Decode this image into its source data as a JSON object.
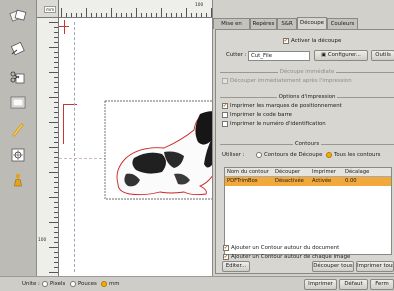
{
  "window": {
    "accent": "#f0b000"
  },
  "tools": {
    "items": [
      {
        "icon": "pages-icon"
      },
      {
        "icon": "edit-icon"
      },
      {
        "icon": "scissors-icon"
      },
      {
        "icon": "frame-icon"
      },
      {
        "icon": "link-icon"
      },
      {
        "icon": "target-icon"
      },
      {
        "icon": "person-icon"
      }
    ]
  },
  "ruler": {
    "unit": "mm",
    "top_label": "100",
    "left_label": "100"
  },
  "tabs": [
    "Mise en page",
    "Repères",
    "S&R",
    "Découpe",
    "Couleurs"
  ],
  "active_tab": "Découpe",
  "cut": {
    "activate_label": "Activer la découpe",
    "cutter_label": "Cutter :",
    "cutter_value": "Cut_File",
    "configure_label": "Configurer...",
    "tools_label": "Outils"
  },
  "immediate": {
    "group_label": "Découpe immédiate",
    "option_label": "Découper immédiatement après l'impression"
  },
  "print_options": {
    "group_label": "Options d'impression",
    "items": [
      {
        "label": "Imprimer les marques de positionnement",
        "checked": true
      },
      {
        "label": "Imprimer le code barre",
        "checked": false
      },
      {
        "label": "Imprimer le numéro d'identification",
        "checked": false
      }
    ]
  },
  "contours": {
    "group_label": "Contours",
    "use_label": "Utiliser :",
    "option_cut": "Contours de Découpe",
    "option_all": "Tous les contours",
    "columns": [
      "Nom du contour",
      "Découper",
      "Imprimer",
      "Décalage"
    ],
    "rows": [
      {
        "name": "PDFTrimBox",
        "cut": "Désactivée",
        "print": "Activée",
        "offset": "0.00"
      }
    ],
    "edit_label": "Editer...",
    "cut_all_label": "Découper tous",
    "print_all_label": "Imprimer tous",
    "add_doc_label": "Ajouter un Contour autour du document",
    "add_image_label": "Ajouter un Contour autour de chaque image"
  },
  "status": {
    "units_label": "Unite :",
    "pixels": "Pixels",
    "inches": "Pouces",
    "mm": "mm",
    "print_label": "Imprimer",
    "default_label": "Défaut",
    "close_label": "Ferm"
  }
}
